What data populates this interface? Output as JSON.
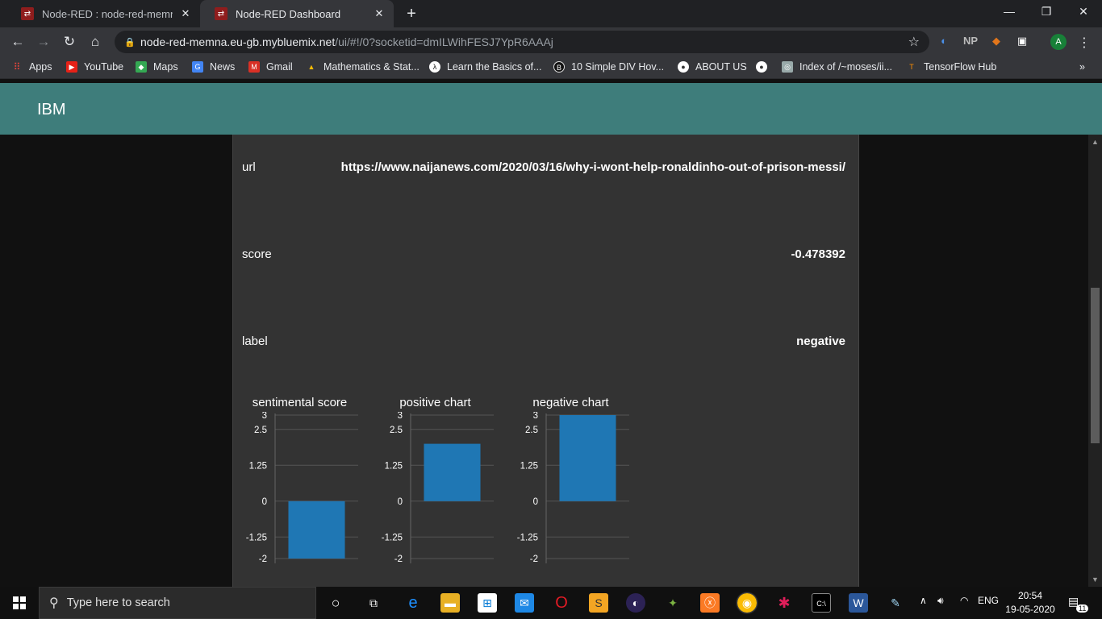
{
  "browser": {
    "tabs": [
      {
        "title": "Node-RED : node-red-memna.eu",
        "active": false
      },
      {
        "title": "Node-RED Dashboard",
        "active": true
      }
    ],
    "address": {
      "host": "node-red-memna.eu-gb.mybluemix.net",
      "path": "/ui/#!/0?socketid=dmILWihFESJ7YpR6AAAj"
    },
    "extensions": {
      "np": "NP"
    },
    "avatar_letter": "A",
    "bookmarks": [
      {
        "label": "Apps",
        "icon": "apps-grid-icon"
      },
      {
        "label": "YouTube",
        "icon": "youtube-icon"
      },
      {
        "label": "Maps",
        "icon": "maps-icon"
      },
      {
        "label": "News",
        "icon": "news-icon"
      },
      {
        "label": "Gmail",
        "icon": "gmail-icon"
      },
      {
        "label": "Mathematics & Stat...",
        "icon": "drive-icon"
      },
      {
        "label": "Learn the Basics of...",
        "icon": "codecademy-icon"
      },
      {
        "label": "10 Simple DIV Hov...",
        "icon": "b-icon"
      },
      {
        "label": "ABOUT US",
        "icon": "globe-icon"
      },
      {
        "label": "",
        "icon": "globe-icon"
      },
      {
        "label": "Index of /~moses/ii...",
        "icon": "site-icon"
      },
      {
        "label": "TensorFlow Hub",
        "icon": "tensorflow-icon"
      }
    ]
  },
  "dashboard": {
    "brand": "IBM",
    "rows": {
      "url_label": "url",
      "url_value": "https://www.naijanews.com/2020/03/16/why-i-wont-help-ronaldinho-out-of-prison-messi/",
      "score_label": "score",
      "score_value": "-0.478392",
      "label_label": "label",
      "label_value": "negative"
    },
    "charts": [
      {
        "title": "sentimental score"
      },
      {
        "title": "positive chart"
      },
      {
        "title": "negative chart"
      }
    ]
  },
  "chart_data": [
    {
      "type": "bar",
      "title": "sentimental score",
      "ylim": [
        -2,
        3
      ],
      "yticks": [
        "3",
        "2.5",
        "1.25",
        "0",
        "-1.25",
        "-2"
      ],
      "values": [
        -2
      ],
      "color": "#1f77b4"
    },
    {
      "type": "bar",
      "title": "positive chart",
      "ylim": [
        -2,
        3
      ],
      "yticks": [
        "3",
        "2.5",
        "1.25",
        "0",
        "-1.25",
        "-2"
      ],
      "values": [
        2
      ],
      "color": "#1f77b4"
    },
    {
      "type": "bar",
      "title": "negative chart",
      "ylim": [
        -2,
        3
      ],
      "yticks": [
        "3",
        "2.5",
        "1.25",
        "0",
        "-1.25",
        "-2"
      ],
      "values": [
        3
      ],
      "color": "#1f77b4"
    }
  ],
  "taskbar": {
    "search_placeholder": "Type here to search",
    "language": "ENG",
    "time": "20:54",
    "date": "19-05-2020",
    "notification_count": "11"
  }
}
